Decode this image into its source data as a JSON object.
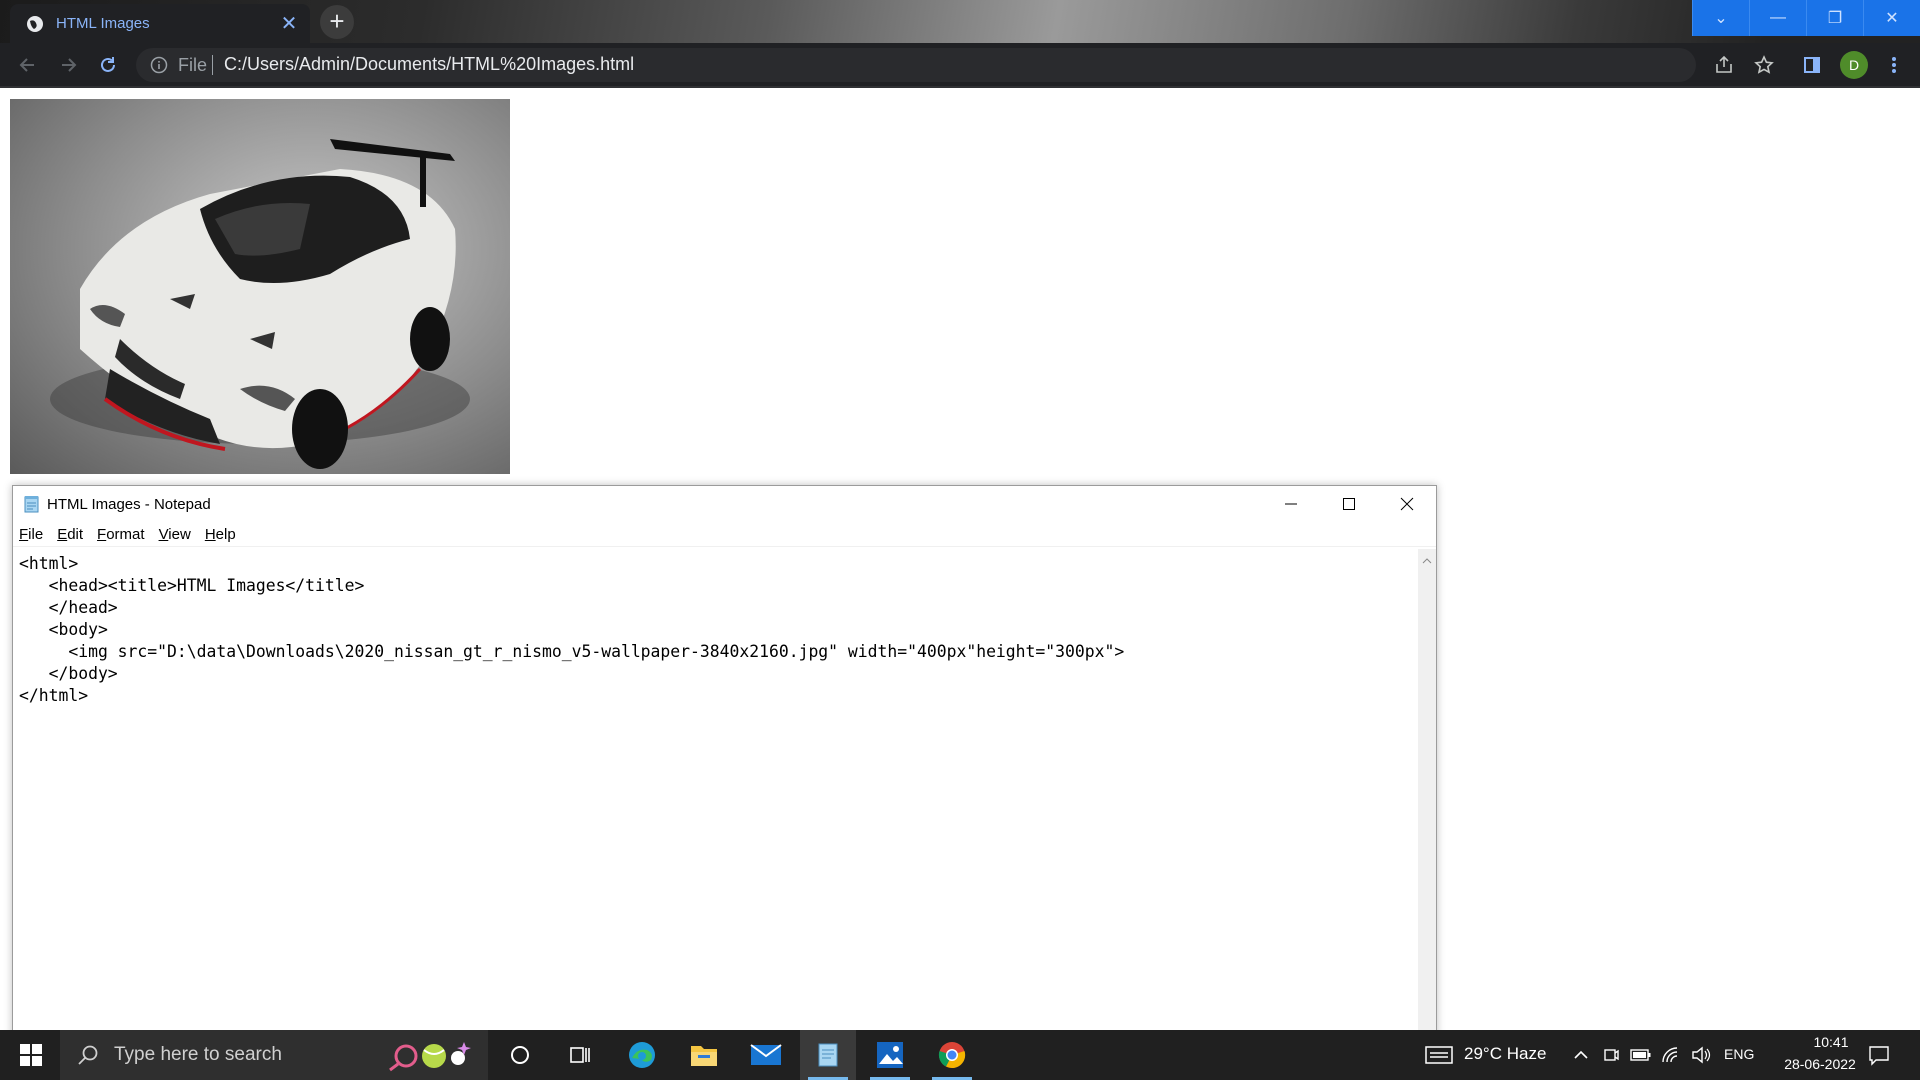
{
  "browser": {
    "tab_title": "HTML Images",
    "tab_close": "✕",
    "new_tab": "+",
    "omnibox_scheme": "File",
    "url": "C:/Users/Admin/Documents/HTML%20Images.html",
    "profile_initial": "D"
  },
  "page": {
    "image_subject": "white Nissan GT-R Nismo sports car"
  },
  "notepad": {
    "title": "HTML Images - Notepad",
    "menu": [
      "File",
      "Edit",
      "Format",
      "View",
      "Help"
    ],
    "content": "<html>\n   <head><title>HTML Images</title>\n   </head>\n   <body>\n     <img src=\"D:\\data\\Downloads\\2020_nissan_gt_r_nismo_v5-wallpaper-3840x2160.jpg\" width=\"400px\"height=\"300px\">\n   </body>\n</html>"
  },
  "taskbar": {
    "search_placeholder": "Type here to search",
    "weather": "29°C  Haze",
    "language": "ENG",
    "time": "10:41",
    "date": "28-06-2022",
    "apps": [
      "cortana-icon",
      "task-view-icon",
      "edge-icon",
      "file-explorer-icon",
      "mail-icon",
      "notepad-icon",
      "photos-icon",
      "chrome-icon"
    ]
  },
  "colors": {
    "chrome_dark": "#202124",
    "tab_text": "#8ab4f8",
    "window_controls": "#1a73e8",
    "taskbar": "#202020",
    "accent_underline": "#76b9ed"
  }
}
